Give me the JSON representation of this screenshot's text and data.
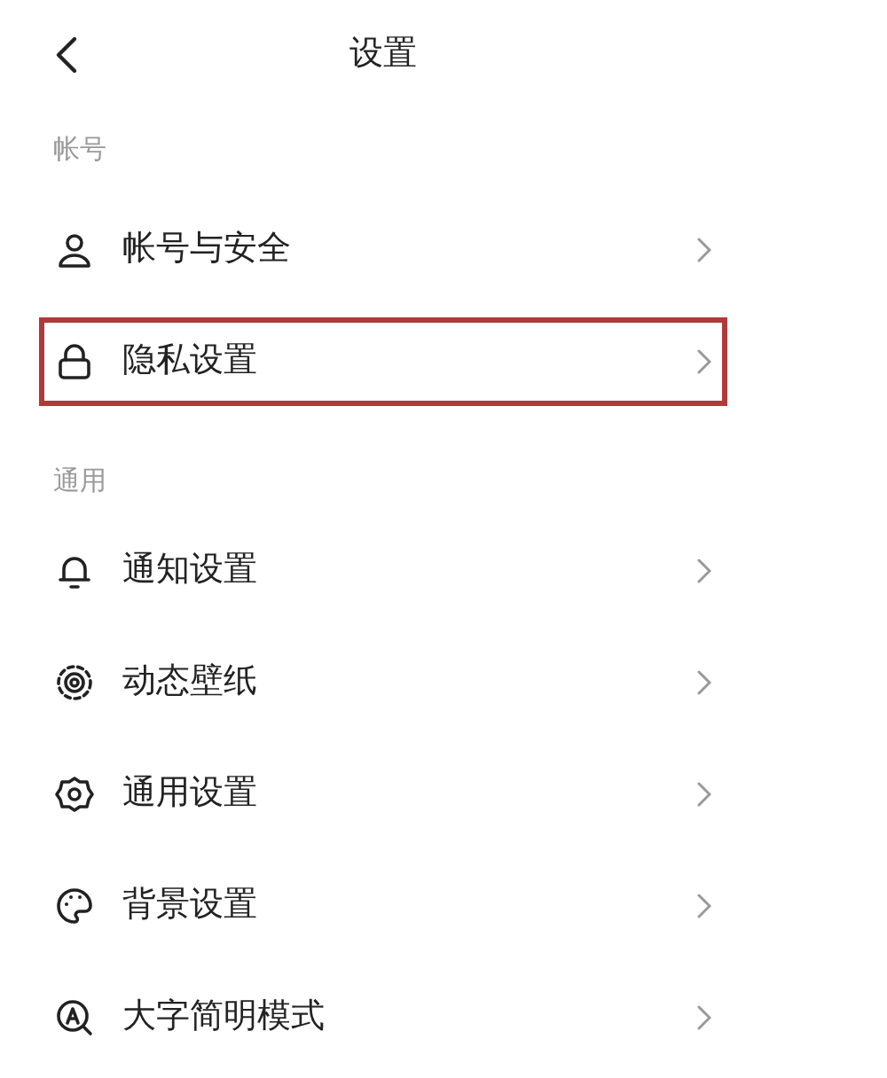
{
  "header": {
    "title": "设置"
  },
  "sections": [
    {
      "title": "帐号",
      "items": [
        {
          "label": "帐号与安全",
          "highlighted": false
        },
        {
          "label": "隐私设置",
          "highlighted": true
        }
      ]
    },
    {
      "title": "通用",
      "items": [
        {
          "label": "通知设置",
          "highlighted": false
        },
        {
          "label": "动态壁纸",
          "highlighted": false
        },
        {
          "label": "通用设置",
          "highlighted": false
        },
        {
          "label": "背景设置",
          "highlighted": false
        },
        {
          "label": "大字简明模式",
          "highlighted": false
        }
      ]
    }
  ]
}
